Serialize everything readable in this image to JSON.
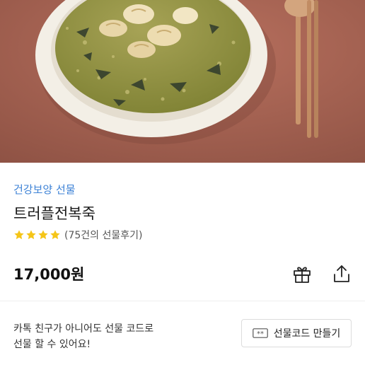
{
  "product": {
    "category": "건강보양 선물",
    "name": "트러플전복죽",
    "rating_stars": 4,
    "review_count_text": "(75건의 선물후기)",
    "price": "17,000원"
  },
  "icons": {
    "gift": "gift-icon",
    "share": "share-icon",
    "code": "gift-code-ticket-icon",
    "star": "star-icon"
  },
  "promo": {
    "line1": "카톡 친구가 아니어도 선물 코드로",
    "line2": "선물 할 수 있어요!",
    "button_label": "선물코드 만들기"
  },
  "colors": {
    "category": "#3d82d6",
    "star": "#f5c518",
    "hero_background": "#a86454"
  }
}
